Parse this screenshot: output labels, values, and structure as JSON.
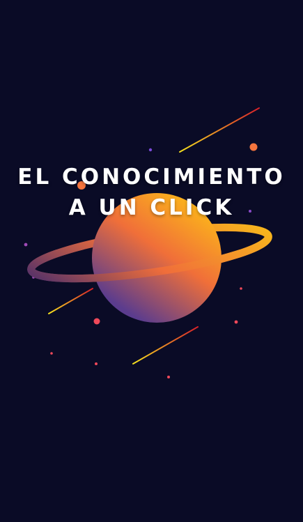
{
  "splash": {
    "headline_line_1": "EL CONOCIMIENTO",
    "headline_line_2": "A UN CLICK"
  },
  "illustration": {
    "icon": "planet-with-ring-icon",
    "background_color": "#0a0b26",
    "colors": {
      "planet_light": "#f9a21f",
      "planet_mid": "#f06a3b",
      "planet_dark": "#5a3a8c",
      "ring_light": "#f5a81e",
      "ring_dark": "#6a3a6c",
      "star_orange": "#f5753e",
      "star_pink": "#f0495a",
      "star_purple": "#7a4ad8",
      "meteor_yellow": "#f5e21e",
      "meteor_red": "#e0262a"
    }
  }
}
